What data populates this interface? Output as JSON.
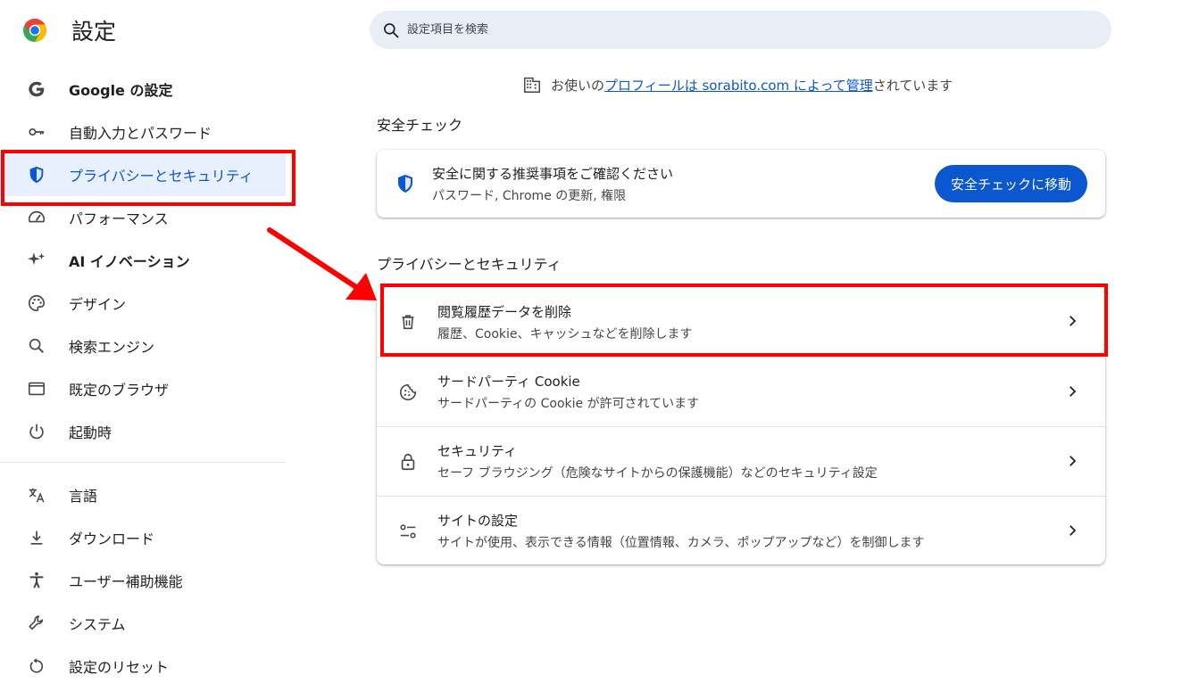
{
  "header": {
    "title": "設定",
    "search_placeholder": "設定項目を検索"
  },
  "sidebar": {
    "items": [
      {
        "label": "Google の設定",
        "icon": "google-g-icon"
      },
      {
        "label": "自動入力とパスワード",
        "icon": "key-icon"
      },
      {
        "label": "プライバシーとセキュリティ",
        "icon": "shield-icon",
        "active": true
      },
      {
        "label": "パフォーマンス",
        "icon": "speedometer-icon"
      },
      {
        "label": "AI イノベーション",
        "icon": "sparkle-icon"
      },
      {
        "label": "デザイン",
        "icon": "palette-icon"
      },
      {
        "label": "検索エンジン",
        "icon": "search-icon"
      },
      {
        "label": "既定のブラウザ",
        "icon": "browser-window-icon"
      },
      {
        "label": "起動時",
        "icon": "power-icon"
      }
    ],
    "items2": [
      {
        "label": "言語",
        "icon": "translate-icon"
      },
      {
        "label": "ダウンロード",
        "icon": "download-icon"
      },
      {
        "label": "ユーザー補助機能",
        "icon": "accessibility-icon"
      },
      {
        "label": "システム",
        "icon": "wrench-icon"
      },
      {
        "label": "設定のリセット",
        "icon": "reset-icon"
      }
    ]
  },
  "managed": {
    "prefix": "お使いの",
    "link": "プロフィールは sorabito.com によって管理",
    "suffix": "されています"
  },
  "safety_check": {
    "section_title": "安全チェック",
    "primary": "安全に関する推奨事項をご確認ください",
    "secondary": "パスワード, Chrome の更新, 権限",
    "button": "安全チェックに移動"
  },
  "privacy": {
    "section_title": "プライバシーとセキュリティ",
    "rows": [
      {
        "primary": "閲覧履歴データを削除",
        "secondary": "履歴、Cookie、キャッシュなどを削除します",
        "icon": "trash-icon"
      },
      {
        "primary": "サードパーティ Cookie",
        "secondary": "サードパーティの Cookie が許可されています",
        "icon": "cookie-icon"
      },
      {
        "primary": "セキュリティ",
        "secondary": "セーフ ブラウジング（危険なサイトからの保護機能）などのセキュリティ設定",
        "icon": "lock-icon"
      },
      {
        "primary": "サイトの設定",
        "secondary": "サイトが使用、表示できる情報（位置情報、カメラ、ポップアップなど）を制御します",
        "icon": "sliders-icon"
      }
    ]
  },
  "colors": {
    "accent": "#0b57d0",
    "annotation": "#ff0000",
    "active_bg": "#e8f0fe"
  }
}
